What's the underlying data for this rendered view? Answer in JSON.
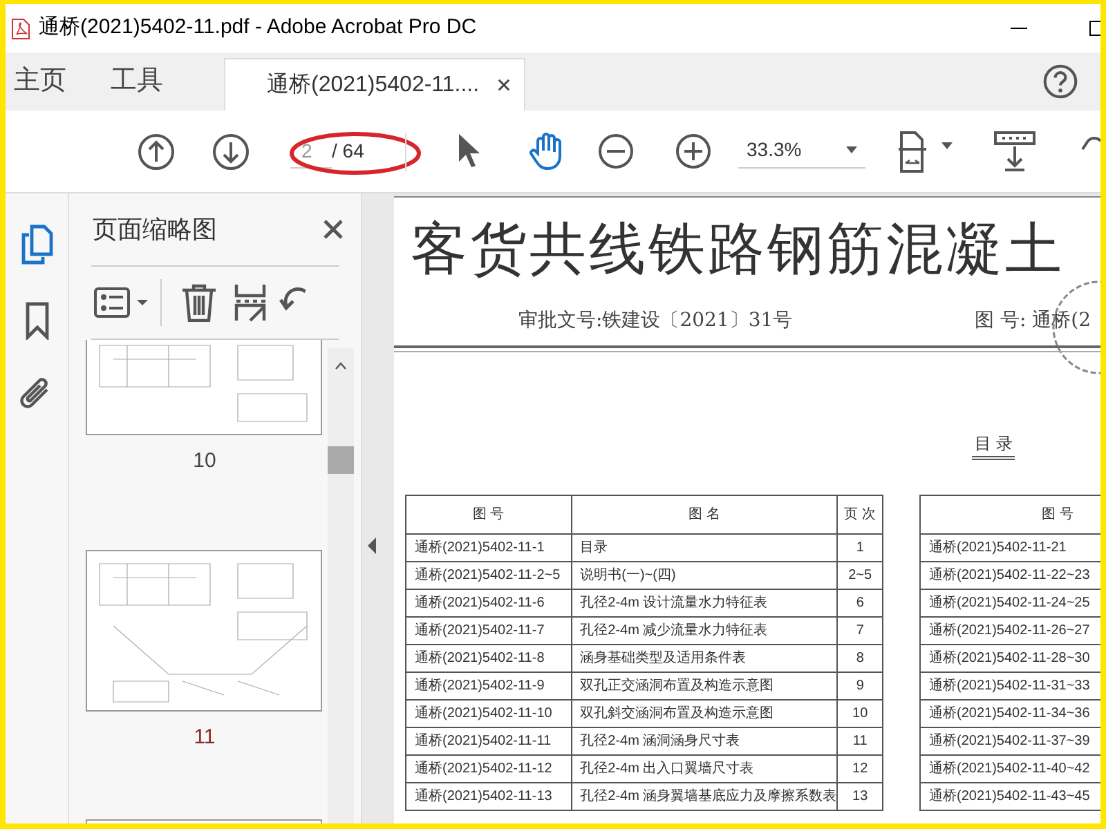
{
  "window": {
    "title": "通桥(2021)5402-11.pdf - Adobe Acrobat Pro DC"
  },
  "nav_tabs": [
    {
      "label": "主页",
      "selected": false
    },
    {
      "label": "工具",
      "selected": false
    },
    {
      "label": "通桥(2021)5402-11....",
      "selected": true
    }
  ],
  "toolbar": {
    "page_value": "2",
    "page_total": "/ 64",
    "zoom": "33.3%"
  },
  "side_panel": {
    "title": "页面缩略图",
    "thumbnails": [
      {
        "label": "10",
        "selected": false
      },
      {
        "label": "11",
        "selected": true
      }
    ]
  },
  "document": {
    "title": "客货共线铁路钢筋混凝土",
    "approval": "审批文号:铁建设〔2021〕31号",
    "drawing_no": "图 号: 通桥(2",
    "toc_heading": "目 录",
    "table_1": {
      "columns": [
        "图 号",
        "图 名",
        "页 次"
      ],
      "rows": [
        [
          "通桥(2021)5402-11-1",
          "目录",
          "1"
        ],
        [
          "通桥(2021)5402-11-2~5",
          "说明书(一)~(四)",
          "2~5"
        ],
        [
          "通桥(2021)5402-11-6",
          "孔径2-4m 设计流量水力特征表",
          "6"
        ],
        [
          "通桥(2021)5402-11-7",
          "孔径2-4m 减少流量水力特征表",
          "7"
        ],
        [
          "通桥(2021)5402-11-8",
          "涵身基础类型及适用条件表",
          "8"
        ],
        [
          "通桥(2021)5402-11-9",
          "双孔正交涵洞布置及构造示意图",
          "9"
        ],
        [
          "通桥(2021)5402-11-10",
          "双孔斜交涵洞布置及构造示意图",
          "10"
        ],
        [
          "通桥(2021)5402-11-11",
          "孔径2-4m 涵洞涵身尺寸表",
          "11"
        ],
        [
          "通桥(2021)5402-11-12",
          "孔径2-4m 出入口翼墙尺寸表",
          "12"
        ],
        [
          "通桥(2021)5402-11-13",
          "孔径2-4m 涵身翼墙基底应力及摩擦系数表",
          "13"
        ]
      ]
    },
    "table_2": {
      "columns": [
        "图 号"
      ],
      "rows": [
        [
          "通桥(2021)5402-11-21"
        ],
        [
          "通桥(2021)5402-11-22~23"
        ],
        [
          "通桥(2021)5402-11-24~25"
        ],
        [
          "通桥(2021)5402-11-26~27"
        ],
        [
          "通桥(2021)5402-11-28~30"
        ],
        [
          "通桥(2021)5402-11-31~33"
        ],
        [
          "通桥(2021)5402-11-34~36"
        ],
        [
          "通桥(2021)5402-11-37~39"
        ],
        [
          "通桥(2021)5402-11-40~42"
        ],
        [
          "通桥(2021)5402-11-43~45"
        ]
      ]
    }
  }
}
